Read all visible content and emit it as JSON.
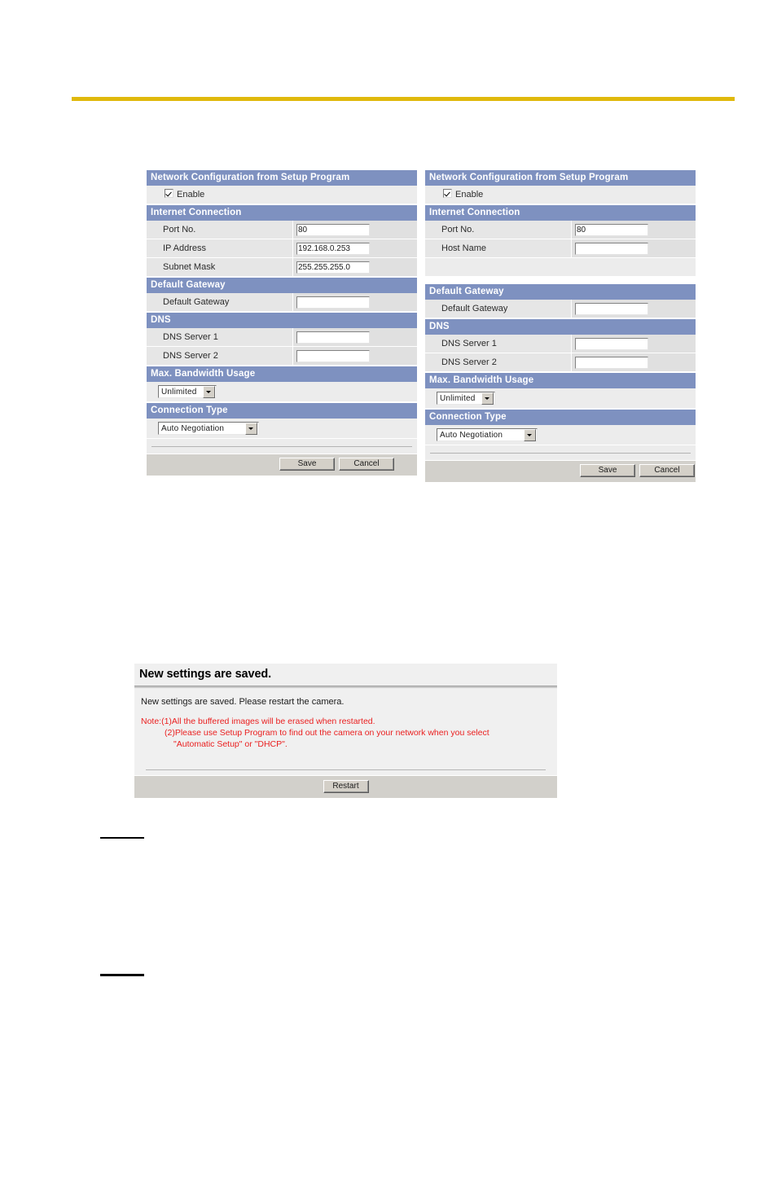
{
  "page": {
    "accent_gold": "#e0b90c",
    "section_header_color": "#7e91c0",
    "note_color": "#ea2020"
  },
  "panels": [
    {
      "id": "static-ip-panel",
      "sections": [
        {
          "header": "Network Configuration from Setup Program",
          "checkbox": {
            "label": "Enable",
            "checked": true
          }
        },
        {
          "header": "Internet Connection",
          "fields": [
            {
              "label": "Port No.",
              "value": "80"
            },
            {
              "label": "IP Address",
              "value": "192.168.0.253"
            },
            {
              "label": "Subnet Mask",
              "value": "255.255.255.0"
            }
          ]
        },
        {
          "header": "Default Gateway",
          "fields": [
            {
              "label": "Default Gateway",
              "value": ""
            }
          ]
        },
        {
          "header": "DNS",
          "fields": [
            {
              "label": "DNS Server 1",
              "value": ""
            },
            {
              "label": "DNS Server 2",
              "value": ""
            }
          ]
        },
        {
          "header": "Max. Bandwidth Usage",
          "select": {
            "value": "Unlimited"
          }
        },
        {
          "header": "Connection Type",
          "select": {
            "value": "Auto Negotiation"
          }
        }
      ],
      "buttons": {
        "save": "Save",
        "cancel": "Cancel"
      }
    },
    {
      "id": "dhcp-panel",
      "sections": [
        {
          "header": "Network Configuration from Setup Program",
          "checkbox": {
            "label": "Enable",
            "checked": true
          }
        },
        {
          "header": "Internet Connection",
          "fields": [
            {
              "label": "Port No.",
              "value": "80"
            },
            {
              "label": "Host Name",
              "value": ""
            }
          ]
        },
        {
          "header": "Default Gateway",
          "fields": [
            {
              "label": "Default Gateway",
              "value": ""
            }
          ]
        },
        {
          "header": "DNS",
          "fields": [
            {
              "label": "DNS Server 1",
              "value": ""
            },
            {
              "label": "DNS Server 2",
              "value": ""
            }
          ]
        },
        {
          "header": "Max. Bandwidth Usage",
          "select": {
            "value": "Unlimited"
          }
        },
        {
          "header": "Connection Type",
          "select": {
            "value": "Auto Negotiation"
          }
        }
      ],
      "buttons": {
        "save": "Save",
        "cancel": "Cancel"
      }
    }
  ],
  "dialog": {
    "title": "New settings are saved.",
    "message": "New settings are saved. Please restart the camera.",
    "note_line1": "Note:(1)All the buffered images will be erased when restarted.",
    "note_line2": "(2)Please use Setup Program to find out the camera on your network when you select",
    "note_line3": "\"Automatic Setup\" or \"DHCP\".",
    "restart_button": "Restart"
  }
}
